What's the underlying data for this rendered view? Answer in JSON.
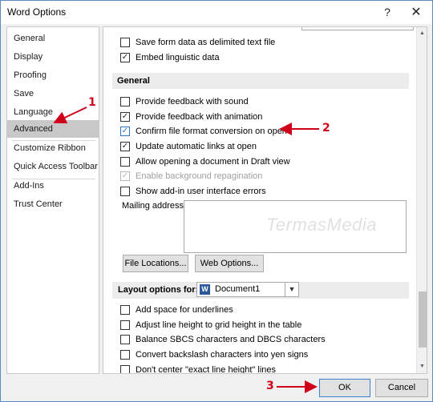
{
  "window": {
    "title": "Word Options",
    "help_glyph": "?",
    "close_glyph": "✕"
  },
  "nav": {
    "items": [
      {
        "label": "General"
      },
      {
        "label": "Display"
      },
      {
        "label": "Proofing"
      },
      {
        "label": "Save"
      },
      {
        "label": "Language"
      },
      {
        "label": "Advanced",
        "selected": true
      },
      {
        "label": "Customize Ribbon"
      },
      {
        "label": "Quick Access Toolbar"
      },
      {
        "label": "Add-Ins"
      },
      {
        "label": "Trust Center"
      }
    ]
  },
  "content": {
    "top_options": [
      {
        "label": "Save form data as delimited text file",
        "checked": false
      },
      {
        "label": "Embed linguistic data",
        "checked": true
      }
    ],
    "general_section": {
      "title": "General",
      "options": [
        {
          "label": "Provide feedback with sound",
          "checked": false
        },
        {
          "label": "Provide feedback with animation",
          "checked": true
        },
        {
          "label": "Confirm file format conversion on open",
          "checked": true
        },
        {
          "label": "Update automatic links at open",
          "checked": true
        },
        {
          "label": "Allow opening a document in Draft view",
          "checked": false
        },
        {
          "label": "Enable background repagination",
          "checked": true,
          "disabled": true
        },
        {
          "label": "Show add-in user interface errors",
          "checked": false
        }
      ],
      "mailing_address_label": "Mailing address:",
      "mailing_address_value": "",
      "file_locations_button": "File Locations...",
      "web_options_button": "Web Options..."
    },
    "layout_section": {
      "title": "Layout options for:",
      "document_select": "Document1",
      "options": [
        {
          "label": "Add space for underlines",
          "checked": false
        },
        {
          "label": "Adjust line height to grid height in the table",
          "checked": false
        },
        {
          "label": "Balance SBCS characters and DBCS characters",
          "checked": false
        },
        {
          "label": "Convert backslash characters into yen signs",
          "checked": false
        },
        {
          "label": "Don't center \"exact line height\" lines",
          "checked": false
        }
      ]
    },
    "watermark": "TermasMedia"
  },
  "footer": {
    "ok_label": "OK",
    "cancel_label": "Cancel"
  },
  "annotations": {
    "step1": "1",
    "step2": "2",
    "step3": "3",
    "color": "#d0021b"
  },
  "colors": {
    "selected_nav": "#c8c8c8",
    "section_bg": "#ececec",
    "checkbox_accent": "#2a72c8",
    "ok_border": "#3c7fd0"
  }
}
